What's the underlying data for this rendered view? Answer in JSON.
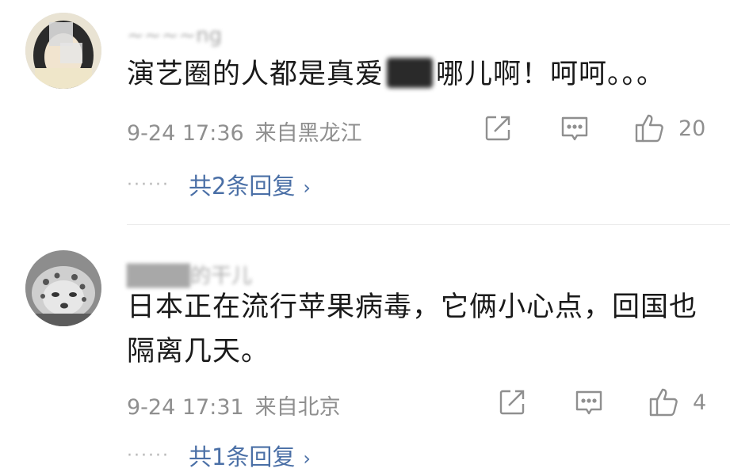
{
  "comments": [
    {
      "username": "~~~~ng",
      "text_before": "演艺圈的人都是真爱",
      "text_after": "哪儿啊！呵呵。。。",
      "time": "9-24 17:36",
      "location": "来自黑龙江",
      "like_count": "20",
      "replies_label": "共2条回复",
      "reply_chevron": "›",
      "reply_dots": "······"
    },
    {
      "username": "████的干儿",
      "text": "日本正在流行苹果病毒，它俩小心点，回国也隔离几天。",
      "time": "9-24 17:31",
      "location": "来自北京",
      "like_count": "4",
      "replies_label": "共1条回复",
      "reply_chevron": "›",
      "reply_dots": "······"
    }
  ],
  "icons": {
    "share": "share-icon",
    "comment": "comment-icon",
    "like": "thumbs-up-icon"
  },
  "colors": {
    "reply_link": "#4a6fa6",
    "meta": "#8f8f8f",
    "text": "#1a1a1a"
  }
}
